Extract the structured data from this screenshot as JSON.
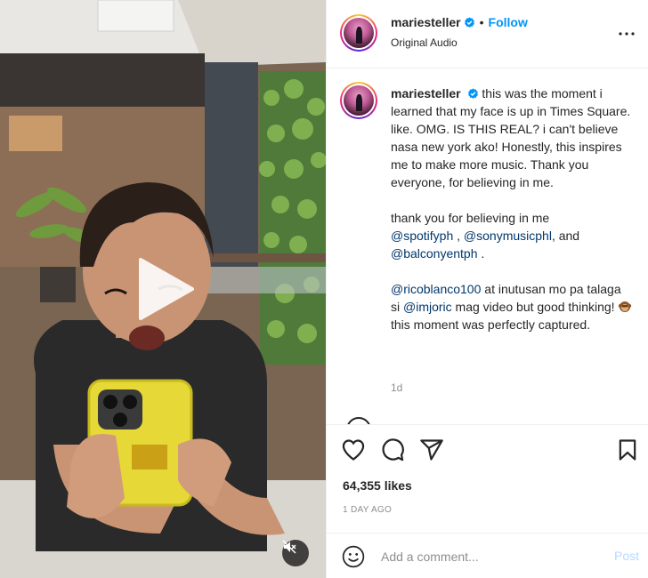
{
  "post": {
    "username": "mariesteller",
    "follow_label": "Follow",
    "separator": "•",
    "audio_label": "Original Audio"
  },
  "caption": {
    "username": "mariesteller",
    "para1": "this was the moment i learned that my face is up in Times Square. like. OMG. IS THIS REAL? i can't believe nasa new york ako! Honestly, this inspires me to make more music. Thank you everyone, for believing in me.",
    "para2_text": "thank you for believing in me",
    "para2_mentions": [
      "@spotifyph",
      "@sonymusicphl",
      "@balconyentph"
    ],
    "para2_sep1": " , ",
    "para2_sep2": ", and",
    "para2_end": " .",
    "para3_mention1": "@ricoblanco100",
    "para3_text1": " at inutusan mo pa talaga si ",
    "para3_mention2": "@imjoric",
    "para3_text2": " mag video but good thinking! ",
    "para3_text3": " this moment was perfectly captured.",
    "age": "1d"
  },
  "stats": {
    "likes": "64,355 likes",
    "date": "1 DAY AGO"
  },
  "comment": {
    "placeholder": "Add a comment...",
    "post_label": "Post"
  },
  "icons": {
    "more": "more-options-icon",
    "like": "heart-icon",
    "comment": "comment-icon",
    "share": "share-icon",
    "save": "bookmark-icon",
    "emoji": "smiley-icon",
    "play": "play-icon",
    "mute": "muted-speaker-icon",
    "verified": "verified-badge-icon"
  },
  "colors": {
    "follow": "#0095f6",
    "mention": "#00376b",
    "post_disabled": "#b3dbff",
    "muted_text": "#8e8e8e"
  }
}
